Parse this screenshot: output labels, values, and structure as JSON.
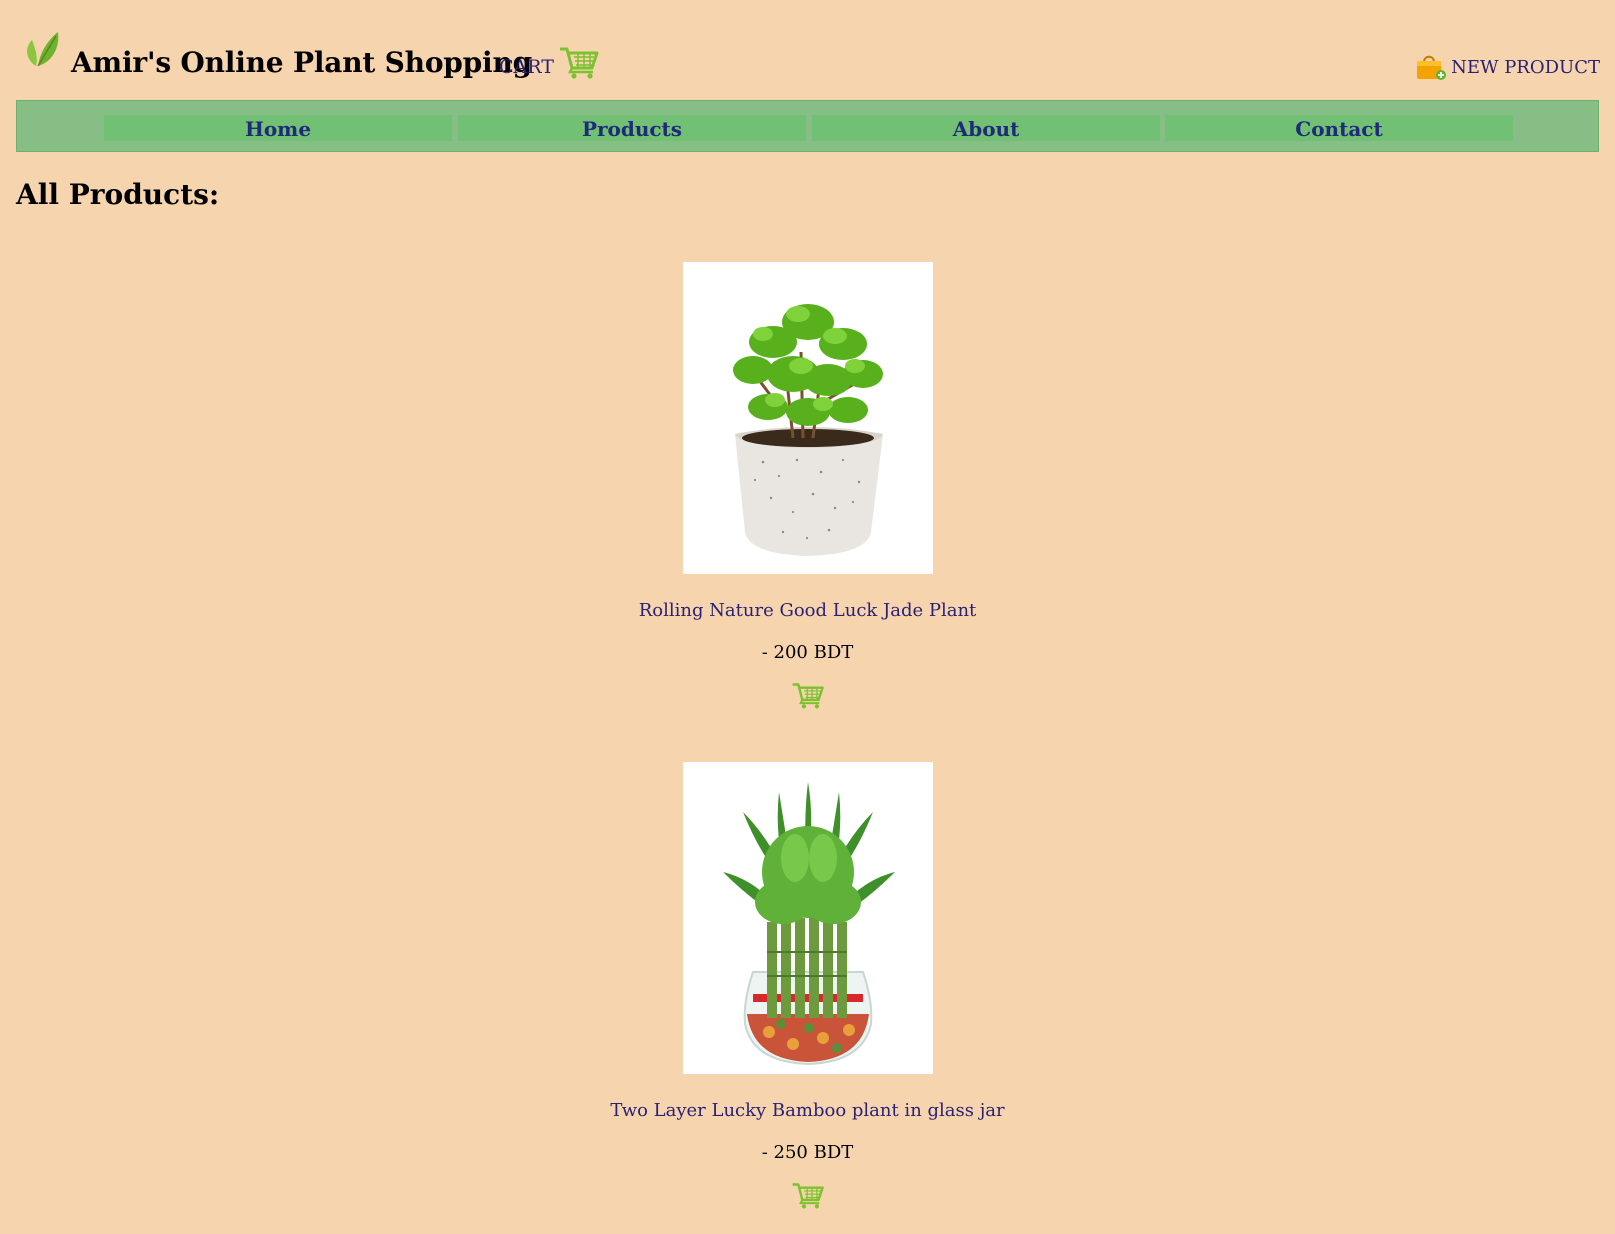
{
  "header": {
    "title": "Amir's Online Plant Shopping",
    "cart_label": "CART",
    "new_product_label": "NEW PRODUCT"
  },
  "nav": {
    "items": [
      {
        "label": "Home"
      },
      {
        "label": "Products"
      },
      {
        "label": "About"
      },
      {
        "label": "Contact"
      }
    ]
  },
  "main": {
    "heading": "All Products:",
    "products": [
      {
        "name": "Rolling Nature Good Luck Jade Plant",
        "price": "- 200 BDT",
        "image_icon": "jade-plant-image"
      },
      {
        "name": "Two Layer Lucky Bamboo plant in glass jar",
        "price": "- 250 BDT",
        "image_icon": "lucky-bamboo-image"
      }
    ]
  },
  "colors": {
    "background": "#f6d5ae",
    "nav_bar": "#86be86",
    "nav_item": "#72c074",
    "nav_text": "#1f2a7a",
    "link_text": "#2a2175",
    "icon_green": "#7cc12e"
  }
}
